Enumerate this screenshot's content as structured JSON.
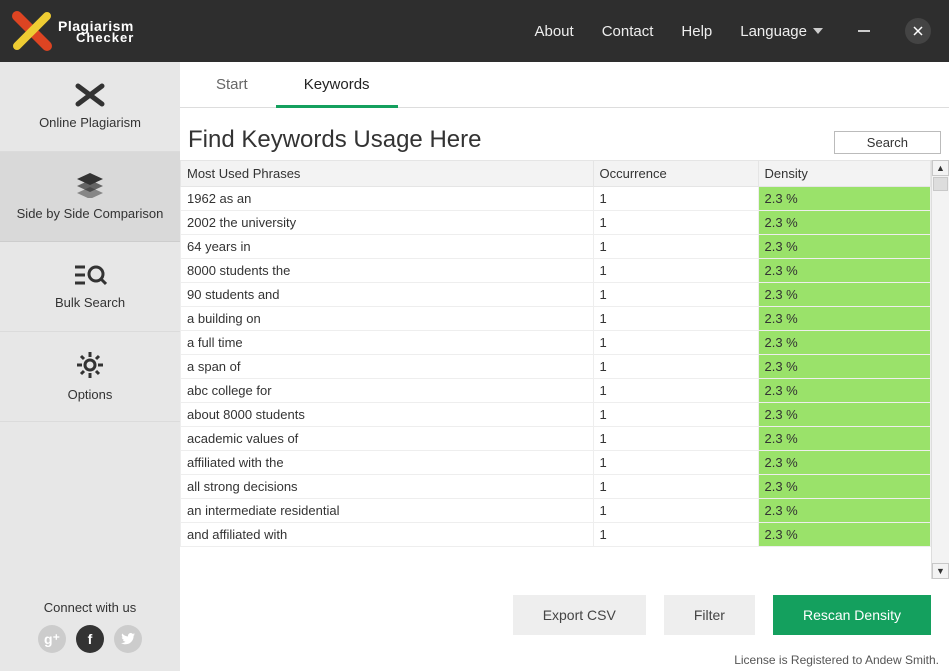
{
  "header": {
    "logo": {
      "top": "Plagiarism",
      "bottom": "Checker"
    },
    "nav": {
      "about": "About",
      "contact": "Contact",
      "help": "Help",
      "language": "Language"
    }
  },
  "sidebar": {
    "items": [
      {
        "label": "Online Plagiarism"
      },
      {
        "label": "Side by Side Comparison"
      },
      {
        "label": "Bulk Search"
      },
      {
        "label": "Options"
      }
    ],
    "connect": "Connect with us"
  },
  "tabs": {
    "start": "Start",
    "keywords": "Keywords"
  },
  "page_title": "Find Keywords Usage Here",
  "search_label": "Search",
  "columns": {
    "phrase": "Most Used Phrases",
    "occurrence": "Occurrence",
    "density": "Density"
  },
  "rows": [
    {
      "phrase": "1962 as an",
      "occurrence": "1",
      "density": "2.3 %"
    },
    {
      "phrase": "2002 the university",
      "occurrence": "1",
      "density": "2.3 %"
    },
    {
      "phrase": "64 years in",
      "occurrence": "1",
      "density": "2.3 %"
    },
    {
      "phrase": "8000 students the",
      "occurrence": "1",
      "density": "2.3 %"
    },
    {
      "phrase": "90 students and",
      "occurrence": "1",
      "density": "2.3 %"
    },
    {
      "phrase": "a building on",
      "occurrence": "1",
      "density": "2.3 %"
    },
    {
      "phrase": "a full time",
      "occurrence": "1",
      "density": "2.3 %"
    },
    {
      "phrase": "a span of",
      "occurrence": "1",
      "density": "2.3 %"
    },
    {
      "phrase": "abc college for",
      "occurrence": "1",
      "density": "2.3 %"
    },
    {
      "phrase": "about 8000 students",
      "occurrence": "1",
      "density": "2.3 %"
    },
    {
      "phrase": "academic values of",
      "occurrence": "1",
      "density": "2.3 %"
    },
    {
      "phrase": "affiliated with the",
      "occurrence": "1",
      "density": "2.3 %"
    },
    {
      "phrase": "all strong decisions",
      "occurrence": "1",
      "density": "2.3 %"
    },
    {
      "phrase": "an intermediate residential",
      "occurrence": "1",
      "density": "2.3 %"
    },
    {
      "phrase": "and affiliated with",
      "occurrence": "1",
      "density": "2.3 %"
    }
  ],
  "actions": {
    "export": "Export CSV",
    "filter": "Filter",
    "rescan": "Rescan Density"
  },
  "status": "License is Registered to Andew Smith."
}
